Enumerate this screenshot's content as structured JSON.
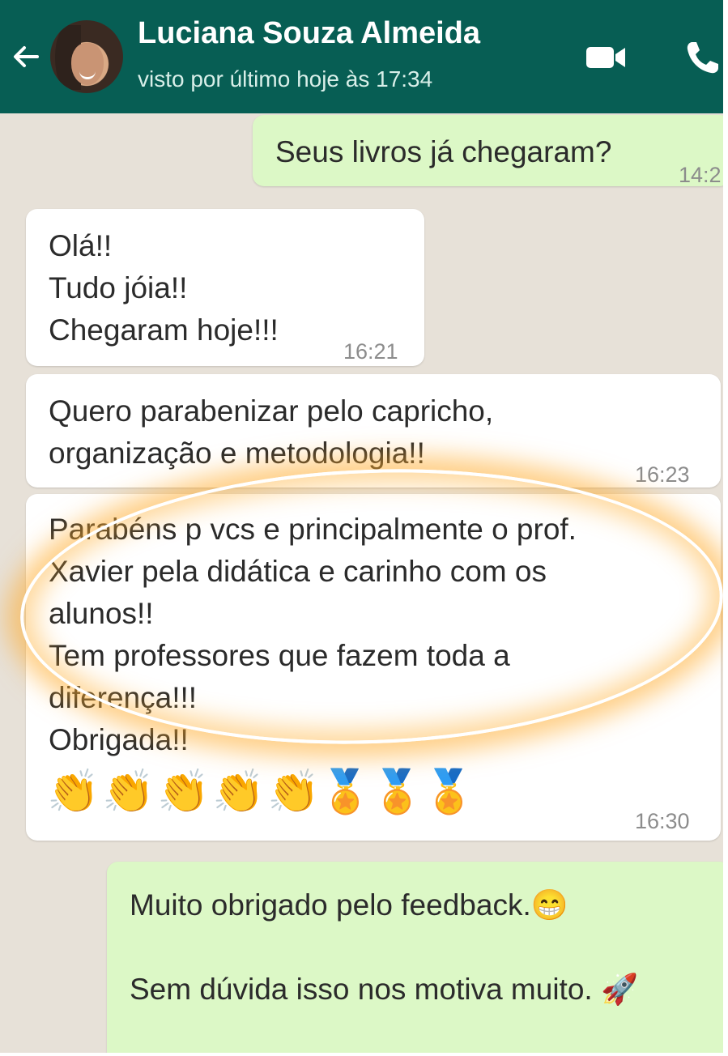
{
  "header": {
    "contact_name": "Luciana Souza Almeida",
    "last_seen": "visto por último hoje às 17:34",
    "back_icon": "arrow-left-icon",
    "video_icon": "video-camera-icon",
    "call_icon": "phone-icon"
  },
  "messages": [
    {
      "direction": "outgoing",
      "lines": [
        "Seus livros já chegaram?"
      ],
      "time": "14:2"
    },
    {
      "direction": "incoming",
      "lines": [
        "Olá!!",
        "Tudo jóia!!",
        "Chegaram hoje!!!"
      ],
      "time": "16:21"
    },
    {
      "direction": "incoming",
      "lines": [
        "Quero parabenizar pelo capricho,",
        "organização e metodologia!!"
      ],
      "time": "16:23"
    },
    {
      "direction": "incoming",
      "lines": [
        "Parabéns p vcs e principalmente o prof.",
        "Xavier pela didática e carinho com os",
        "alunos!!",
        "Tem professores que fazem toda a",
        "diferença!!!",
        "Obrigada!!"
      ],
      "emojis": [
        "👏",
        "👏",
        "👏",
        "👏",
        "👏",
        "🏅",
        "🏅",
        "🏅"
      ],
      "time": "16:30"
    },
    {
      "direction": "outgoing",
      "lines": [
        "Muito obrigado pelo feedback.😁",
        "",
        "Sem dúvida isso nos motiva muito. 🚀"
      ]
    }
  ],
  "colors": {
    "header": "#075e54",
    "incoming_bubble": "#ffffff",
    "outgoing_bubble": "#dcf8c6",
    "chat_background": "#e7e1d8",
    "highlight": "#ffaa28"
  }
}
